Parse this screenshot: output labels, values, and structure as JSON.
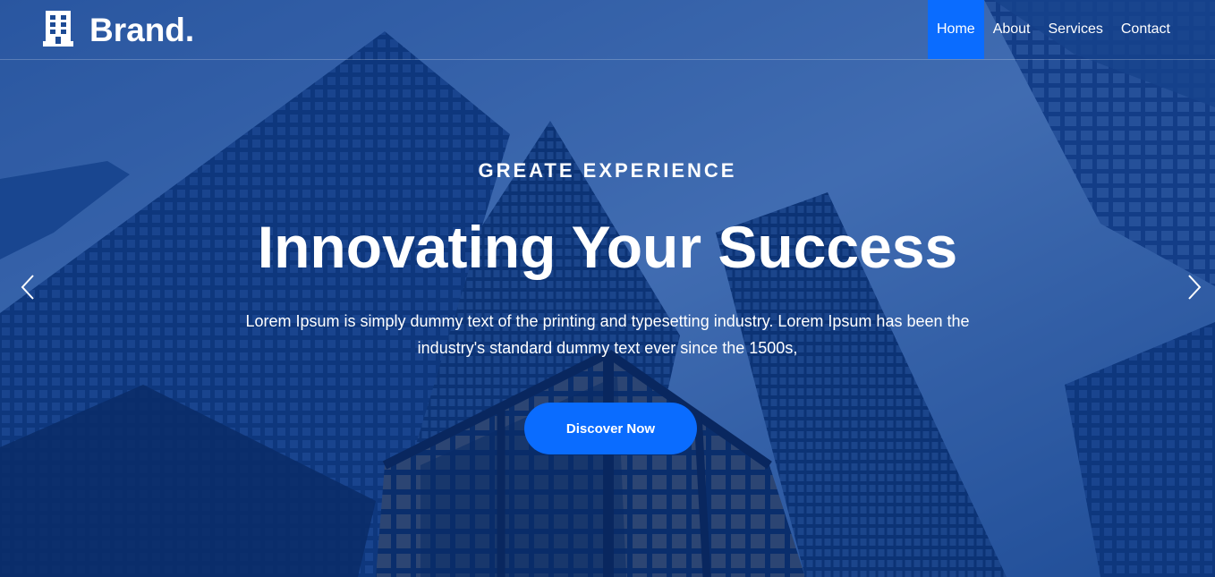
{
  "brand": {
    "name": "Brand.",
    "logo_icon": "building-icon"
  },
  "nav": {
    "items": [
      {
        "label": "Home",
        "active": true
      },
      {
        "label": "About",
        "active": false
      },
      {
        "label": "Services",
        "active": false
      },
      {
        "label": "Contact",
        "active": false
      }
    ]
  },
  "hero": {
    "eyebrow": "GREATE EXPERIENCE",
    "headline": "Innovating Your Success",
    "description": "Lorem Ipsum is simply dummy text of the printing and typesetting industry. Lorem Ipsum has been the industry's standard dummy text ever since the 1500s,",
    "cta_label": "Discover Now"
  },
  "carousel": {
    "prev_icon": "chevron-left-icon",
    "next_icon": "chevron-right-icon"
  },
  "colors": {
    "accent": "#0a6cff",
    "overlay": "#0b2f6b",
    "text": "#ffffff"
  }
}
